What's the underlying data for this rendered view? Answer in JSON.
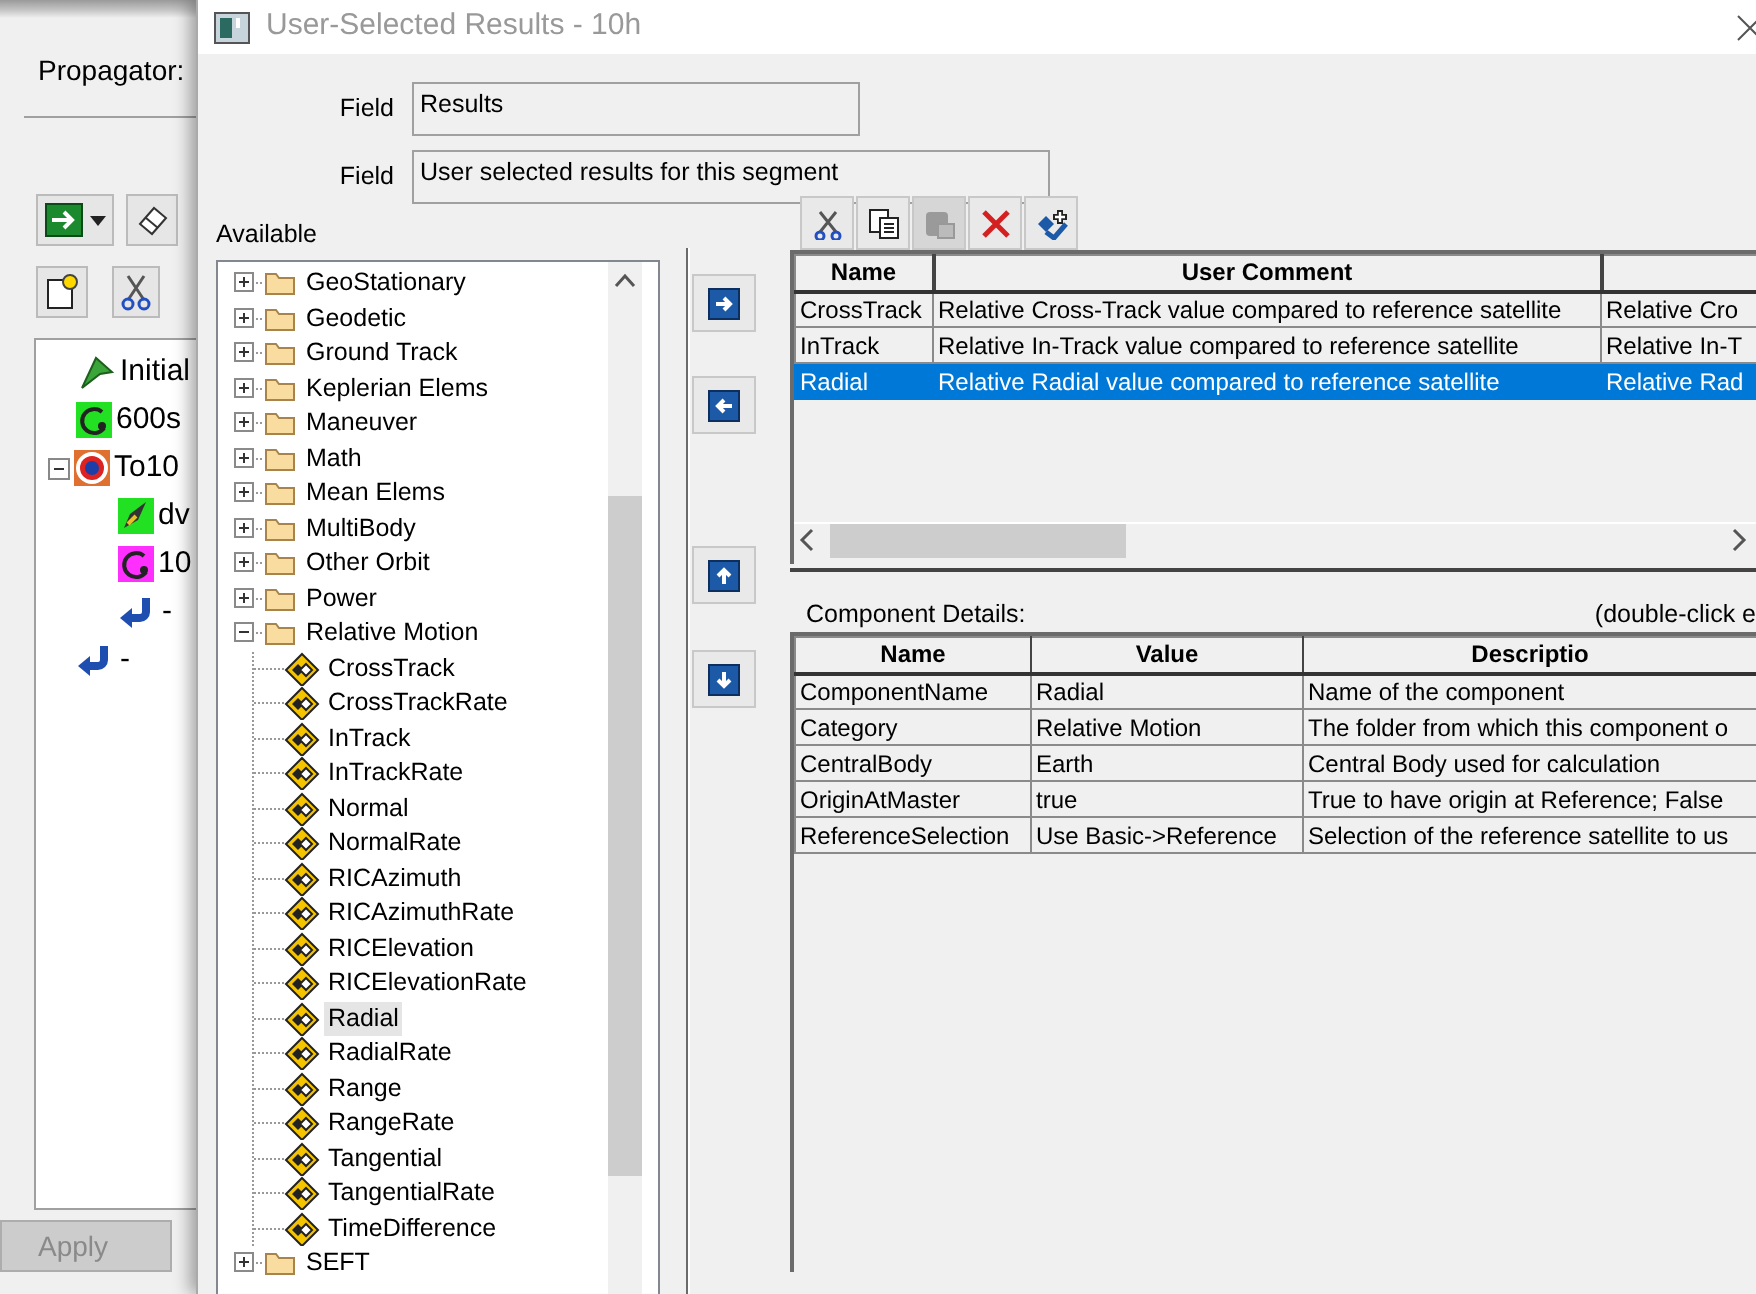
{
  "background_window": {
    "propagator_label": "Propagator:",
    "tree": [
      {
        "label": "Initial",
        "kind": "initial"
      },
      {
        "label": "600s",
        "kind": "propagate"
      },
      {
        "label": "To10",
        "kind": "target",
        "expanded": true,
        "children": [
          {
            "label": "dv",
            "kind": "maneuver"
          },
          {
            "label": "10",
            "kind": "propagate_active"
          },
          {
            "label": "-",
            "kind": "return"
          }
        ]
      },
      {
        "label": "-",
        "kind": "return"
      }
    ],
    "apply_button": {
      "label": "Apply",
      "disabled": true
    }
  },
  "dialog": {
    "title": "User-Selected Results - 10h",
    "fields": [
      {
        "label": "Field",
        "value": "Results"
      },
      {
        "label": "Field",
        "value": "User selected results for this segment"
      }
    ],
    "available_label": "Available",
    "tree": [
      {
        "label": "GeoStationary",
        "expanded": false,
        "selected": false
      },
      {
        "label": "Geodetic",
        "expanded": false,
        "selected": false
      },
      {
        "label": "Ground Track",
        "expanded": false,
        "selected": false
      },
      {
        "label": "Keplerian Elems",
        "expanded": false,
        "selected": false
      },
      {
        "label": "Maneuver",
        "expanded": false,
        "selected": false
      },
      {
        "label": "Math",
        "expanded": false,
        "selected": false
      },
      {
        "label": "Mean Elems",
        "expanded": false,
        "selected": false
      },
      {
        "label": "MultiBody",
        "expanded": false,
        "selected": false
      },
      {
        "label": "Other Orbit",
        "expanded": false,
        "selected": false
      },
      {
        "label": "Power",
        "expanded": false,
        "selected": false
      },
      {
        "label": "Relative Motion",
        "expanded": true,
        "selected": false,
        "children": [
          {
            "label": "CrossTrack",
            "selected": false
          },
          {
            "label": "CrossTrackRate",
            "selected": false
          },
          {
            "label": "InTrack",
            "selected": false
          },
          {
            "label": "InTrackRate",
            "selected": false
          },
          {
            "label": "Normal",
            "selected": false
          },
          {
            "label": "NormalRate",
            "selected": false
          },
          {
            "label": "RICAzimuth",
            "selected": false
          },
          {
            "label": "RICAzimuthRate",
            "selected": false
          },
          {
            "label": "RICElevation",
            "selected": false
          },
          {
            "label": "RICElevationRate",
            "selected": false
          },
          {
            "label": "Radial",
            "selected": true
          },
          {
            "label": "RadialRate",
            "selected": false
          },
          {
            "label": "Range",
            "selected": false
          },
          {
            "label": "RangeRate",
            "selected": false
          },
          {
            "label": "Tangential",
            "selected": false
          },
          {
            "label": "TangentialRate",
            "selected": false
          },
          {
            "label": "TimeDifference",
            "selected": false
          }
        ]
      },
      {
        "label": "SEFT",
        "expanded": false,
        "selected": false
      }
    ],
    "move_buttons": [
      {
        "kind": "right"
      },
      {
        "kind": "left"
      },
      {
        "kind": "up"
      },
      {
        "kind": "down"
      }
    ],
    "toolbar": [
      {
        "kind": "cut",
        "disabled": false
      },
      {
        "kind": "copy",
        "disabled": false
      },
      {
        "kind": "paste",
        "disabled": true
      },
      {
        "kind": "delete",
        "disabled": false
      },
      {
        "kind": "add",
        "disabled": false
      }
    ],
    "results_table": {
      "columns": [
        "Name",
        "User Comment"
      ],
      "rows": [
        {
          "name": "CrossTrack",
          "user_comment": "Relative Cross-Track value compared to reference satellite",
          "column_3": "Relative Cro",
          "selected": false
        },
        {
          "name": "InTrack",
          "user_comment": "Relative In-Track value compared to reference satellite",
          "column_3": "Relative In-T",
          "selected": false
        },
        {
          "name": "Radial",
          "user_comment": "Relative Radial value compared to reference satellite",
          "column_3": "Relative Rad",
          "selected": true
        }
      ]
    },
    "details_label": "Component Details:",
    "details_hint": "(double-click e",
    "details_table": {
      "columns": [
        "Name",
        "Value",
        "Descriptio"
      ],
      "rows": [
        [
          "ComponentName",
          "Radial",
          "Name of the component"
        ],
        [
          "Category",
          "Relative Motion",
          "The folder from which this component o"
        ],
        [
          "CentralBody",
          "Earth",
          "Central Body used for calculation"
        ],
        [
          "OriginAtMaster",
          "true",
          "True to have origin at Reference; False"
        ],
        [
          "ReferenceSelection",
          "Use Basic->Reference",
          "Selection of the reference satellite to us"
        ]
      ]
    }
  }
}
